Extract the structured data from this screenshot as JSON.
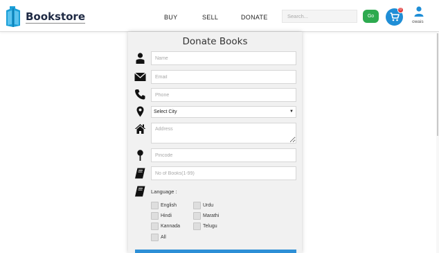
{
  "brand": {
    "name": "Bookstore"
  },
  "nav": {
    "buy": "BUY",
    "sell": "SELL",
    "donate": "DONATE"
  },
  "search": {
    "placeholder": "Search...",
    "go_label": "Go"
  },
  "cart": {
    "badge": "0"
  },
  "user": {
    "name": "owais"
  },
  "form": {
    "title": "Donate Books",
    "name_placeholder": "Name",
    "email_placeholder": "Email",
    "phone_placeholder": "Phone",
    "city_selected": "Select City",
    "address_placeholder": "Address",
    "pincode_placeholder": "Pincode",
    "books_placeholder": "No of Books(1-99)",
    "language_label": "Language :",
    "languages": [
      "English",
      "Urdu",
      "Hindi",
      "Marathi",
      "Kannada",
      "Telugu",
      "All"
    ]
  },
  "colors": {
    "accent": "#2d8fd6",
    "go": "#2daa4f",
    "badge": "#e23b3b"
  }
}
